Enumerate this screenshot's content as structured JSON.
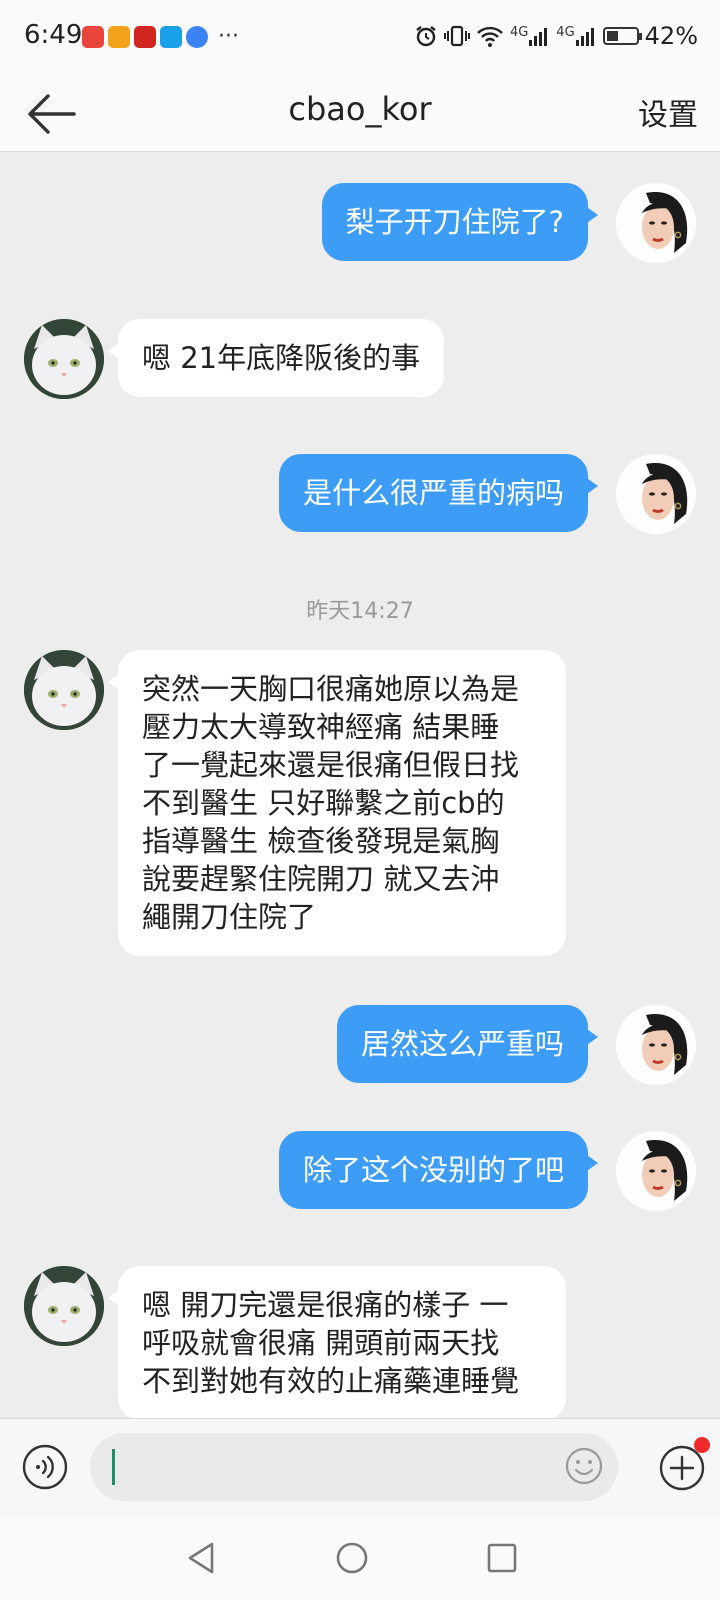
{
  "status_bar": {
    "time": "6:49",
    "more": "···",
    "signal_a": "4G",
    "signal_b": "4G",
    "battery": "42%",
    "battery_level": 0.42,
    "app_icons": [
      "#e8453c",
      "#f3a21c",
      "#d1261f",
      "#1aa0e8",
      "#3b82f6"
    ]
  },
  "header": {
    "title": "cbao_kor",
    "settings_label": "设置"
  },
  "messages": [
    {
      "from": "me",
      "text": "梨子开刀住院了?"
    },
    {
      "from": "other",
      "text": "嗯 21年底降阪後的事"
    },
    {
      "from": "me",
      "text": "是什么很严重的病吗"
    },
    {
      "from": "timestamp",
      "text": "昨天14:27"
    },
    {
      "from": "other",
      "lines": [
        "突然一天胸口很痛她原以為是",
        "壓力太大導致神經痛 結果睡",
        "了一覺起來還是很痛但假日找",
        "不到醫生 只好聯繫之前cb的",
        "指導醫生 檢查後發現是氣胸",
        "說要趕緊住院開刀 就又去沖",
        "繩開刀住院了"
      ]
    },
    {
      "from": "me",
      "text": "居然这么严重吗"
    },
    {
      "from": "me",
      "text": "除了这个没别的了吧"
    },
    {
      "from": "other",
      "lines": [
        "嗯 開刀完還是很痛的樣子 一",
        "呼吸就會很痛 開頭前兩天找",
        "不到對她有效的止痛藥連睡覺"
      ]
    }
  ],
  "input": {
    "placeholder": ""
  },
  "colors": {
    "my_bubble": "#3d9cf5",
    "other_bubble": "#ffffff",
    "background": "#ededed",
    "notification_dot": "#f02b2b"
  }
}
